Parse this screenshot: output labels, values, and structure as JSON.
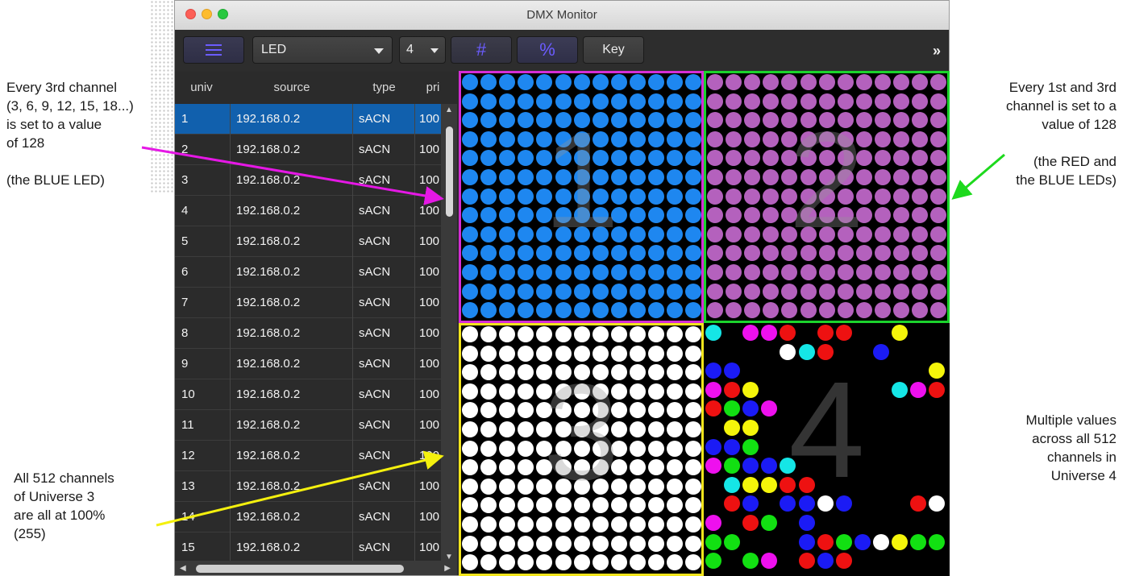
{
  "window": {
    "title": "DMX Monitor"
  },
  "toolbar": {
    "menu_icon": "hamburger-icon",
    "fixture_value": "LED",
    "universe_count_value": "4",
    "hash_label": "#",
    "percent_label": "%",
    "key_label": "Key",
    "more_label": "»",
    "colors": {
      "accent": "#6b5cff"
    }
  },
  "table": {
    "headers": {
      "univ": "univ",
      "source": "source",
      "type": "type",
      "pri": "pri"
    },
    "selected_row": 0,
    "rows": [
      {
        "univ": "1",
        "source": "192.168.0.2",
        "type": "sACN",
        "pri": "100"
      },
      {
        "univ": "2",
        "source": "192.168.0.2",
        "type": "sACN",
        "pri": "100"
      },
      {
        "univ": "3",
        "source": "192.168.0.2",
        "type": "sACN",
        "pri": "100"
      },
      {
        "univ": "4",
        "source": "192.168.0.2",
        "type": "sACN",
        "pri": "100"
      },
      {
        "univ": "5",
        "source": "192.168.0.2",
        "type": "sACN",
        "pri": "100"
      },
      {
        "univ": "6",
        "source": "192.168.0.2",
        "type": "sACN",
        "pri": "100"
      },
      {
        "univ": "7",
        "source": "192.168.0.2",
        "type": "sACN",
        "pri": "100"
      },
      {
        "univ": "8",
        "source": "192.168.0.2",
        "type": "sACN",
        "pri": "100"
      },
      {
        "univ": "9",
        "source": "192.168.0.2",
        "type": "sACN",
        "pri": "100"
      },
      {
        "univ": "10",
        "source": "192.168.0.2",
        "type": "sACN",
        "pri": "100"
      },
      {
        "univ": "11",
        "source": "192.168.0.2",
        "type": "sACN",
        "pri": "100"
      },
      {
        "univ": "12",
        "source": "192.168.0.2",
        "type": "sACN",
        "pri": "100"
      },
      {
        "univ": "13",
        "source": "192.168.0.2",
        "type": "sACN",
        "pri": "100"
      },
      {
        "univ": "14",
        "source": "192.168.0.2",
        "type": "sACN",
        "pri": "100"
      },
      {
        "univ": "15",
        "source": "192.168.0.2",
        "type": "sACN",
        "pri": "100"
      }
    ]
  },
  "universes": [
    {
      "label": "1",
      "border_color": "#d52dd5",
      "dot_color": "#1e87f0"
    },
    {
      "label": "2",
      "border_color": "#1bd32c",
      "dot_color": "#b461bd"
    },
    {
      "label": "3",
      "border_color": "#f2e51c",
      "dot_color": "#ffffff"
    },
    {
      "label": "4",
      "border_color": "",
      "dot_color": "mixed"
    }
  ],
  "palette_u4": [
    "#000000",
    "#1b1bf5",
    "#ee1111",
    "#12e012",
    "#15e6e6",
    "#ee10ee",
    "#f5f50a",
    "#ffffff"
  ],
  "u4_pattern": [
    "44..5.5.2...2222....66.5..",
    "........7.4.2.....1..1.5..",
    "1.1....3.1.....4.4...1..6.",
    "5.2.6..1.2..........4.5.2.",
    "2.3.1.5..........7.3...2..",
    "..6.6..5...6.3.4.1.4.2.5..",
    "1.1.3..........1.......5..",
    "5.3.1.1.4..5.5.3.1.5.2.3.1",
    "..4.6.6.2.2......3.2.3.1..",
    "..2.1...1.1.7.1.......2.7.",
    "5...2.3...1....2.1.......1",
    "3.3.......1.2.3.1.7.6.3.3.",
    "3...3.5...2.1.2....1.2.3.."
  ],
  "annotations": {
    "a1": [
      "Every 3rd channel",
      "(3, 6, 9, 12, 15, 18...)",
      "is set to a value",
      "of 128",
      "",
      "(the BLUE LED)"
    ],
    "a2": [
      "Every 1st and 3rd",
      "channel is set to a",
      "value of 128",
      "",
      "(the RED and",
      "the BLUE LEDs)"
    ],
    "a3": [
      "All 512 channels",
      "of Universe 3",
      "are all at 100%",
      "(255)"
    ],
    "a4": [
      "Multiple values",
      "across all 512",
      "channels in",
      "Universe 4"
    ],
    "colors": {
      "magenta": "#e518e5",
      "green": "#1dd91d",
      "yellow": "#f4f00e"
    }
  }
}
